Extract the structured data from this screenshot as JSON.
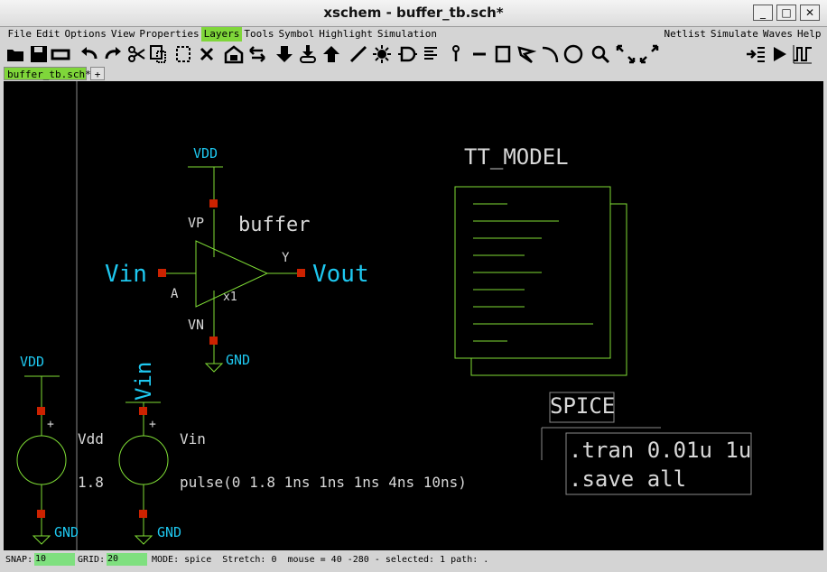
{
  "window": {
    "title": "xschem - buffer_tb.sch*",
    "controls": [
      "_",
      "□",
      "✕"
    ]
  },
  "menu": {
    "left": [
      "File",
      "Edit",
      "Options",
      "View",
      "Properties",
      "Layers",
      "Tools",
      "Symbol",
      "Highlight",
      "Simulation"
    ],
    "active": "Layers",
    "right": [
      "Netlist",
      "Simulate",
      "Waves",
      "Help"
    ]
  },
  "toolbar_icons": [
    "open-icon",
    "save-icon",
    "reload-icon",
    "undo-icon",
    "redo-icon",
    "cut-icon",
    "copy-icon",
    "paste-icon",
    "delete-icon",
    "push-icon",
    "pop-icon",
    "move-down-icon",
    "insert-symbol-icon",
    "move-up-icon",
    "wire-icon",
    "highlight-icon",
    "symbol-icon",
    "text-list-icon",
    "pin-icon",
    "line-icon",
    "rect-icon",
    "polygon-icon",
    "arc-icon",
    "circle-icon",
    "zoom-icon",
    "zoom-fit-icon",
    "zoom-out-icon",
    "netlist-icon",
    "simulate-icon",
    "waves-icon"
  ],
  "tabs": {
    "current": "buffer_tb.sch*",
    "add": "+"
  },
  "schematic": {
    "colors": {
      "bg": "#000000",
      "wire": "#7fdd35",
      "pin": "#cc2200",
      "label": "#1ec8f0",
      "text": "#d8d8d8"
    },
    "buffer": {
      "vdd": "VDD",
      "vp": "VP",
      "name": "buffer",
      "y": "Y",
      "vout": "Vout",
      "vin": "Vin",
      "a": "A",
      "inst": "x1",
      "vn": "VN",
      "gnd": "GND"
    },
    "model": {
      "title": "TT_MODEL"
    },
    "spice": {
      "title": "SPICE",
      "lines": [
        ".tran 0.01u 1u",
        ".save all"
      ]
    },
    "vdd_source": {
      "top": "VDD",
      "name": "Vdd",
      "value": "1.8",
      "plus": "+",
      "gnd": "GND"
    },
    "vin_source": {
      "top": "Vin",
      "name": "Vin",
      "value": "pulse(0 1.8 1ns 1ns 1ns 4ns 10ns)",
      "plus": "+",
      "gnd": "GND"
    }
  },
  "status": {
    "snap_label": "SNAP:",
    "snap": "10",
    "grid_label": "GRID:",
    "grid": "20",
    "text": "MODE: spice  Stretch: 0  mouse = 40 -280 - selected: 1 path: ."
  }
}
